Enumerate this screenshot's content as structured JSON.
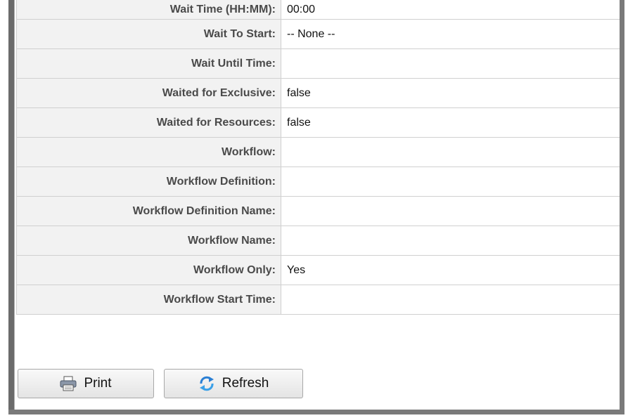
{
  "properties": [
    {
      "label": "Wait Time (HH:MM):",
      "value": "00:00"
    },
    {
      "label": "Wait To Start:",
      "value": "-- None --"
    },
    {
      "label": "Wait Until Time:",
      "value": ""
    },
    {
      "label": "Waited for Exclusive:",
      "value": "false"
    },
    {
      "label": "Waited for Resources:",
      "value": "false"
    },
    {
      "label": "Workflow:",
      "value": ""
    },
    {
      "label": "Workflow Definition:",
      "value": ""
    },
    {
      "label": "Workflow Definition Name:",
      "value": ""
    },
    {
      "label": "Workflow Name:",
      "value": ""
    },
    {
      "label": "Workflow Only:",
      "value": "Yes"
    },
    {
      "label": "Workflow Start Time:",
      "value": ""
    }
  ],
  "buttons": {
    "print_label": "Print",
    "refresh_label": "Refresh",
    "print_icon": "printer-icon",
    "refresh_icon": "refresh-icon"
  }
}
